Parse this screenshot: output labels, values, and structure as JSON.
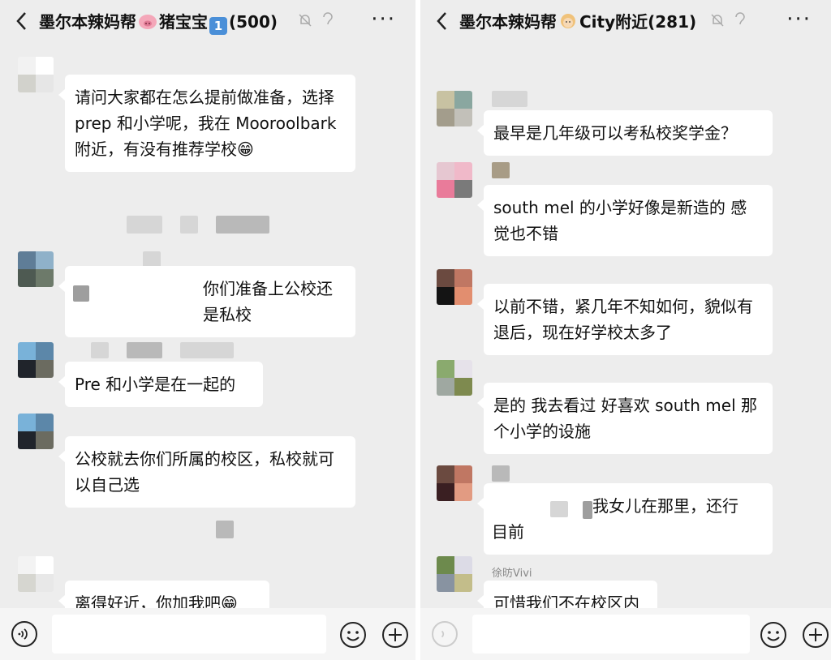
{
  "left": {
    "title": "墨尔本辣妈帮",
    "title_suffix": "猪宝宝",
    "title_count_badge": "1",
    "title_count": "(500)",
    "messages": [
      {
        "text": "请问大家都在怎么提前做准备，选择 prep 和小学呢，我在 Mooroolbark 附近，有没有推荐学校😁"
      },
      {
        "text": "你们准备上公校还是私校"
      },
      {
        "text": "Pre 和小学是在一起的"
      },
      {
        "text": "公校就去你们所属的校区，私校就可以自己选"
      },
      {
        "text": "离得好近，你加我吧😁"
      }
    ]
  },
  "right": {
    "title": "墨尔本辣妈帮",
    "title_suffix": "City附近(281)",
    "messages": [
      {
        "text": "最早是几年级可以考私校奖学金？"
      },
      {
        "text": "south mel 的小学好像是新造的 感觉也不错"
      },
      {
        "text": "以前不错，紧几年不知如何，貌似有退后，现在好学校太多了"
      },
      {
        "text": "是的 我去看过 好喜欢 south mel 那个小学的设施"
      },
      {
        "text": "我女儿在那里，还行",
        "text2": "目前"
      },
      {
        "sender": "徐昉Vivi",
        "text": "可惜我们不在校区内"
      }
    ]
  },
  "colors": {
    "background": "#ededed",
    "bubble": "#ffffff",
    "muted_text": "#888888"
  },
  "icons": [
    "back-arrow-icon",
    "pig-emoji-icon",
    "keycap-1-icon",
    "mute-bell-icon",
    "earpiece-icon",
    "more-icon",
    "voice-icon",
    "emoji-icon",
    "plus-icon",
    "girl-emoji-icon"
  ]
}
